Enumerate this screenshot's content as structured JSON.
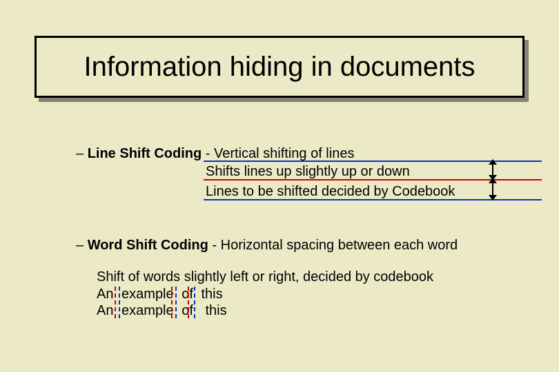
{
  "title": "Information hiding in documents",
  "items": {
    "lineShift": {
      "dash": "–",
      "label": "Line Shift Coding",
      "sep": " - ",
      "desc0": "Vertical shifting of lines",
      "desc1": "Shifts lines up slightly up or down",
      "desc2": "Lines to be shifted decided by Codebook"
    },
    "wordShift": {
      "dash": "–",
      "label": "Word Shift Coding",
      "sep": " - ",
      "desc": "Horizontal spacing between each word",
      "body0": "Shift of words slightly left or right, decided by codebook",
      "ex1": {
        "w0": "An",
        "w1": "example",
        "w2": "of",
        "w3": "this"
      },
      "ex2": {
        "w0": "An",
        "w1": "example",
        "w2": "of",
        "w3": "this"
      }
    }
  }
}
